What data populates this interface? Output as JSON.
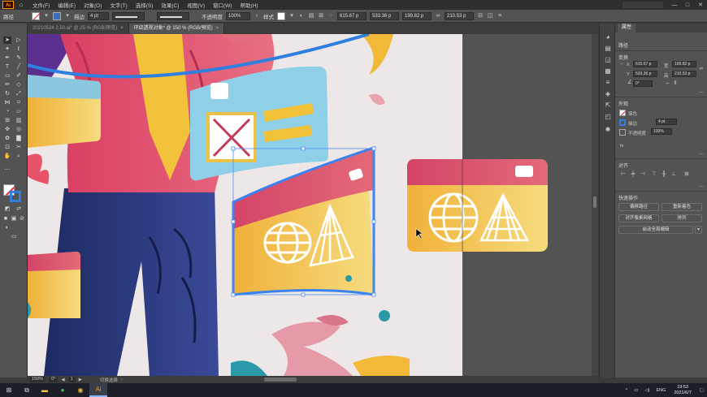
{
  "menubar": {
    "app_logo": "Ai",
    "items": [
      "文件(F)",
      "编辑(E)",
      "对象(O)",
      "文字(T)",
      "选择(S)",
      "效果(C)",
      "视图(V)",
      "窗口(W)",
      "帮助(H)"
    ],
    "window_controls": [
      "—",
      "□",
      "✕"
    ]
  },
  "controlbar": {
    "selection_label": "路径",
    "stroke_label": "描边",
    "stroke_weight": "4 pt",
    "stroke_style": "等比",
    "brush": "基本",
    "opacity_label": "不透明度",
    "opacity_value": "100%",
    "style_label": "样式",
    "x_value": "615.67 p",
    "y_value": "533.36 p",
    "w_value": "199.82 p",
    "h_value": "210.53 p"
  },
  "tabs": [
    {
      "label": "20210524 2.50.ai* @ 25 % (RGB/预览)",
      "close": "×",
      "active": false
    },
    {
      "label": "环绕透视对象* @ 150 % (RGB/预览)",
      "close": "×",
      "active": true
    }
  ],
  "properties": {
    "tab": "属性",
    "selection_type": "路径",
    "transform_title": "变换",
    "x_label": "X",
    "x_value": "615.67 p",
    "y_label": "Y",
    "y_value": "533.36 p",
    "w_label": "宽",
    "w_value": "199.82 p",
    "h_label": "高",
    "h_value": "210.53 p",
    "angle_value": "0°",
    "appearance_title": "外观",
    "fill_label": "填色",
    "stroke_label": "描边",
    "stroke_value": "4 pt",
    "opacity_label": "不透明度",
    "opacity_value": "100%",
    "fx_label": "fx.",
    "align_title": "对齐",
    "quick_actions_title": "快速操作",
    "btn_offset_path": "偏移路径",
    "btn_recolor": "重新着色",
    "btn_align_pixel": "对齐像素网格",
    "btn_arrange": "排列",
    "btn_global_edit": "启动全局编辑",
    "more": "..."
  },
  "statusbar": {
    "zoom": "150%",
    "angle": "0°",
    "artboard": "1",
    "tool_status": "切换选择"
  },
  "taskbar": {
    "ime": "ENG",
    "time": "19:53",
    "date": "2021/6/7"
  },
  "colors": {
    "accent_selection": "#3a82f0",
    "card_pink": "#d44a6a",
    "card_yellow": "#f2b838",
    "artboard_bg": "#ede7e8"
  }
}
